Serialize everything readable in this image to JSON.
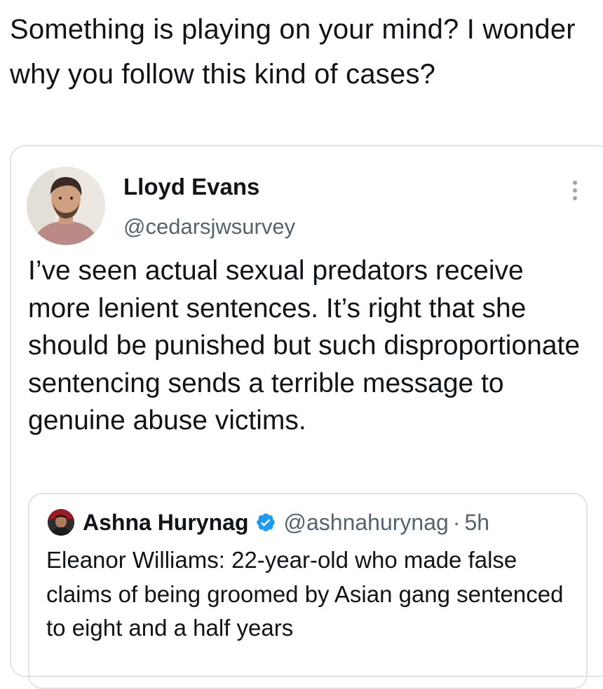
{
  "tweet": {
    "text": "Something is playing on your mind? I wonder why you follow this kind of cases?"
  },
  "quoted_tweet": {
    "author_name": "Lloyd Evans",
    "author_handle": "@cedarsjwsurvey",
    "more_icon": "more-vertical-icon",
    "text": "I’ve seen actual sexual predators receive more lenient sentences. It’s right that she should be punished but such disproportionate sentencing sends a terrible message to genuine abuse victims.",
    "nested_quote": {
      "author_name": "Ashna Hurynag",
      "verified_icon": "verified-badge-icon",
      "author_handle": "@ashnahurynag",
      "separator": "·",
      "timestamp": "5h",
      "text": "Eleanor Williams: 22-year-old who made false claims of being groomed by Asian gang sentenced to eight and a half years"
    }
  },
  "colors": {
    "text_primary": "#0f1419",
    "text_secondary": "#536471",
    "border": "#dfe4e8",
    "verified": "#1d9bf0"
  }
}
